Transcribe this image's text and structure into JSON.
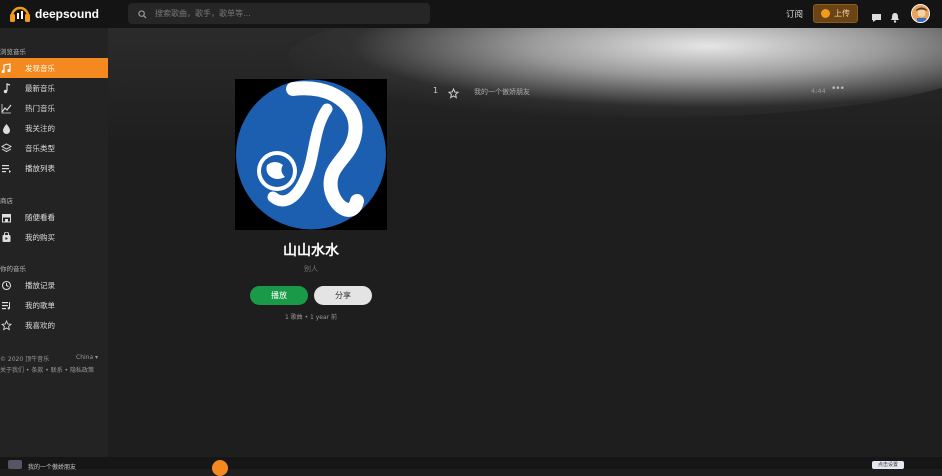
{
  "brand": {
    "name": "deepsound"
  },
  "search": {
    "placeholder": "搜索歌曲，歌手，歌单等..."
  },
  "header": {
    "subscribe": "订阅",
    "upload": "上传"
  },
  "sidebar": {
    "section_browse": "浏览音乐",
    "browse_items": [
      {
        "label": "发现音乐",
        "icon": "music-note-icon",
        "active": true
      },
      {
        "label": "最新音乐",
        "icon": "single-note-icon"
      },
      {
        "label": "热门音乐",
        "icon": "trending-icon"
      },
      {
        "label": "我关注的",
        "icon": "drop-icon"
      },
      {
        "label": "音乐类型",
        "icon": "layers-icon"
      },
      {
        "label": "播放列表",
        "icon": "playlist-icon"
      }
    ],
    "section_store": "商店",
    "store_items": [
      {
        "label": "随便看看",
        "icon": "store-icon"
      },
      {
        "label": "我的购买",
        "icon": "bag-icon"
      }
    ],
    "section_mine": "你的音乐",
    "mine_items": [
      {
        "label": "播放记录",
        "icon": "history-icon"
      },
      {
        "label": "我的歌单",
        "icon": "my-playlist-icon"
      },
      {
        "label": "我喜欢的",
        "icon": "star-icon"
      }
    ],
    "footer_copyright": "© 2020 顶牛音乐",
    "footer_region": "China ▾",
    "footer_links": "关于我们 • 条款 • 联系 • 隐私政策"
  },
  "album": {
    "title": "山山水水",
    "subtitle": "别人",
    "play_label": "播放",
    "share_label": "分享",
    "meta": "1 歌曲 • 1 year 前"
  },
  "tracks": [
    {
      "num": "1",
      "name": "我的一个傲娇朋友",
      "duration": "4:44",
      "more": "•••"
    }
  ],
  "player": {
    "title": "我的一个傲娇朋友",
    "settings_label": "点击设置"
  },
  "colors": {
    "accent": "#f4891f",
    "play": "#1a9a48",
    "cover_blue": "#1c5fb0"
  }
}
